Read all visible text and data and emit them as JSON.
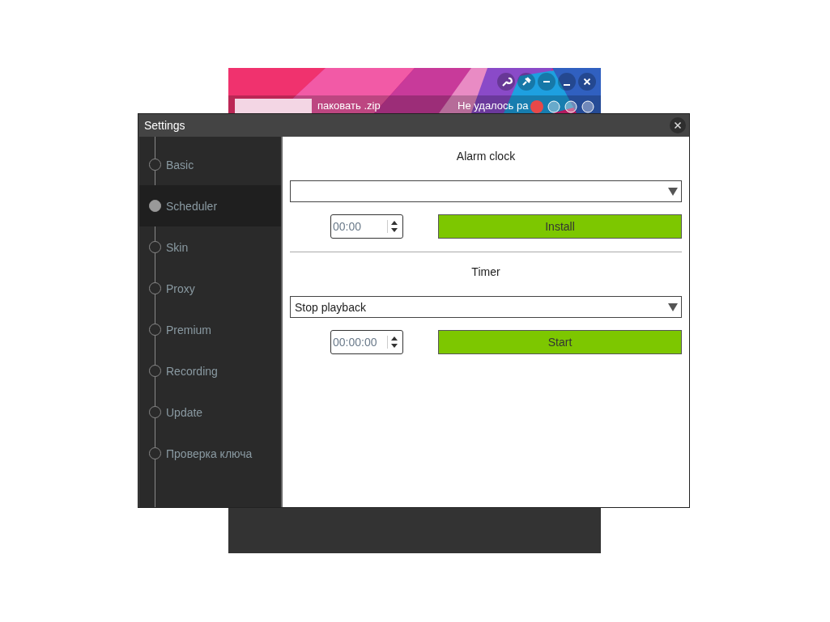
{
  "background_window": {
    "file_label": "паковать .zip",
    "status_text": "Не удалось ра"
  },
  "window": {
    "title": "Settings"
  },
  "sidebar": {
    "items": [
      {
        "label": "Basic",
        "selected": false
      },
      {
        "label": "Scheduler",
        "selected": true
      },
      {
        "label": "Skin",
        "selected": false
      },
      {
        "label": "Proxy",
        "selected": false
      },
      {
        "label": "Premium",
        "selected": false
      },
      {
        "label": "Recording",
        "selected": false
      },
      {
        "label": "Update",
        "selected": false
      },
      {
        "label": "Проверка ключа",
        "selected": false
      }
    ]
  },
  "sections": [
    {
      "heading": "Alarm clock",
      "time": "00:00",
      "button": "Install"
    },
    {
      "heading": "Timer",
      "dropdown": "Stop playback",
      "time": "00:00:00",
      "button": "Start"
    }
  ]
}
